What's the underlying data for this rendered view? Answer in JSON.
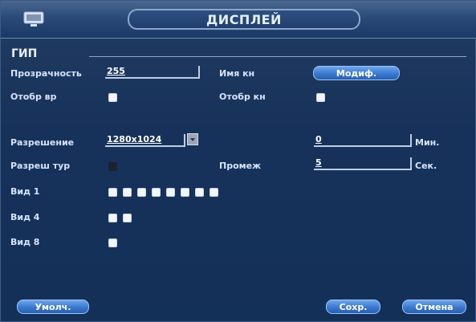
{
  "title": "ДИСПЛЕЙ",
  "section": "ГИП",
  "transparency": {
    "label": "Прозрачность",
    "value": "255"
  },
  "channel_name": {
    "label": "Имя кн",
    "button": "Модиф."
  },
  "show_time": {
    "label": "Отобр вр",
    "checked": true
  },
  "show_channel": {
    "label": "Отобр кн",
    "checked": true
  },
  "resolution": {
    "label": "Разрешение",
    "value": "1280x1024"
  },
  "minutes": {
    "value": "0",
    "unit": "Мин."
  },
  "tour": {
    "label": "Разреш тур",
    "checked": false
  },
  "interval": {
    "label": "Промеж",
    "value": "5",
    "unit": "Сек."
  },
  "view1": {
    "label": "Вид 1",
    "count": 8
  },
  "view4": {
    "label": "Вид 4",
    "count": 2
  },
  "view8": {
    "label": "Вид 8",
    "count": 1
  },
  "buttons": {
    "default": "Умолч.",
    "save": "Сохр.",
    "cancel": "Отмена"
  },
  "colors": {
    "accent": "#3a79cf",
    "background": "#17325a",
    "text": "#d7e4ff"
  }
}
